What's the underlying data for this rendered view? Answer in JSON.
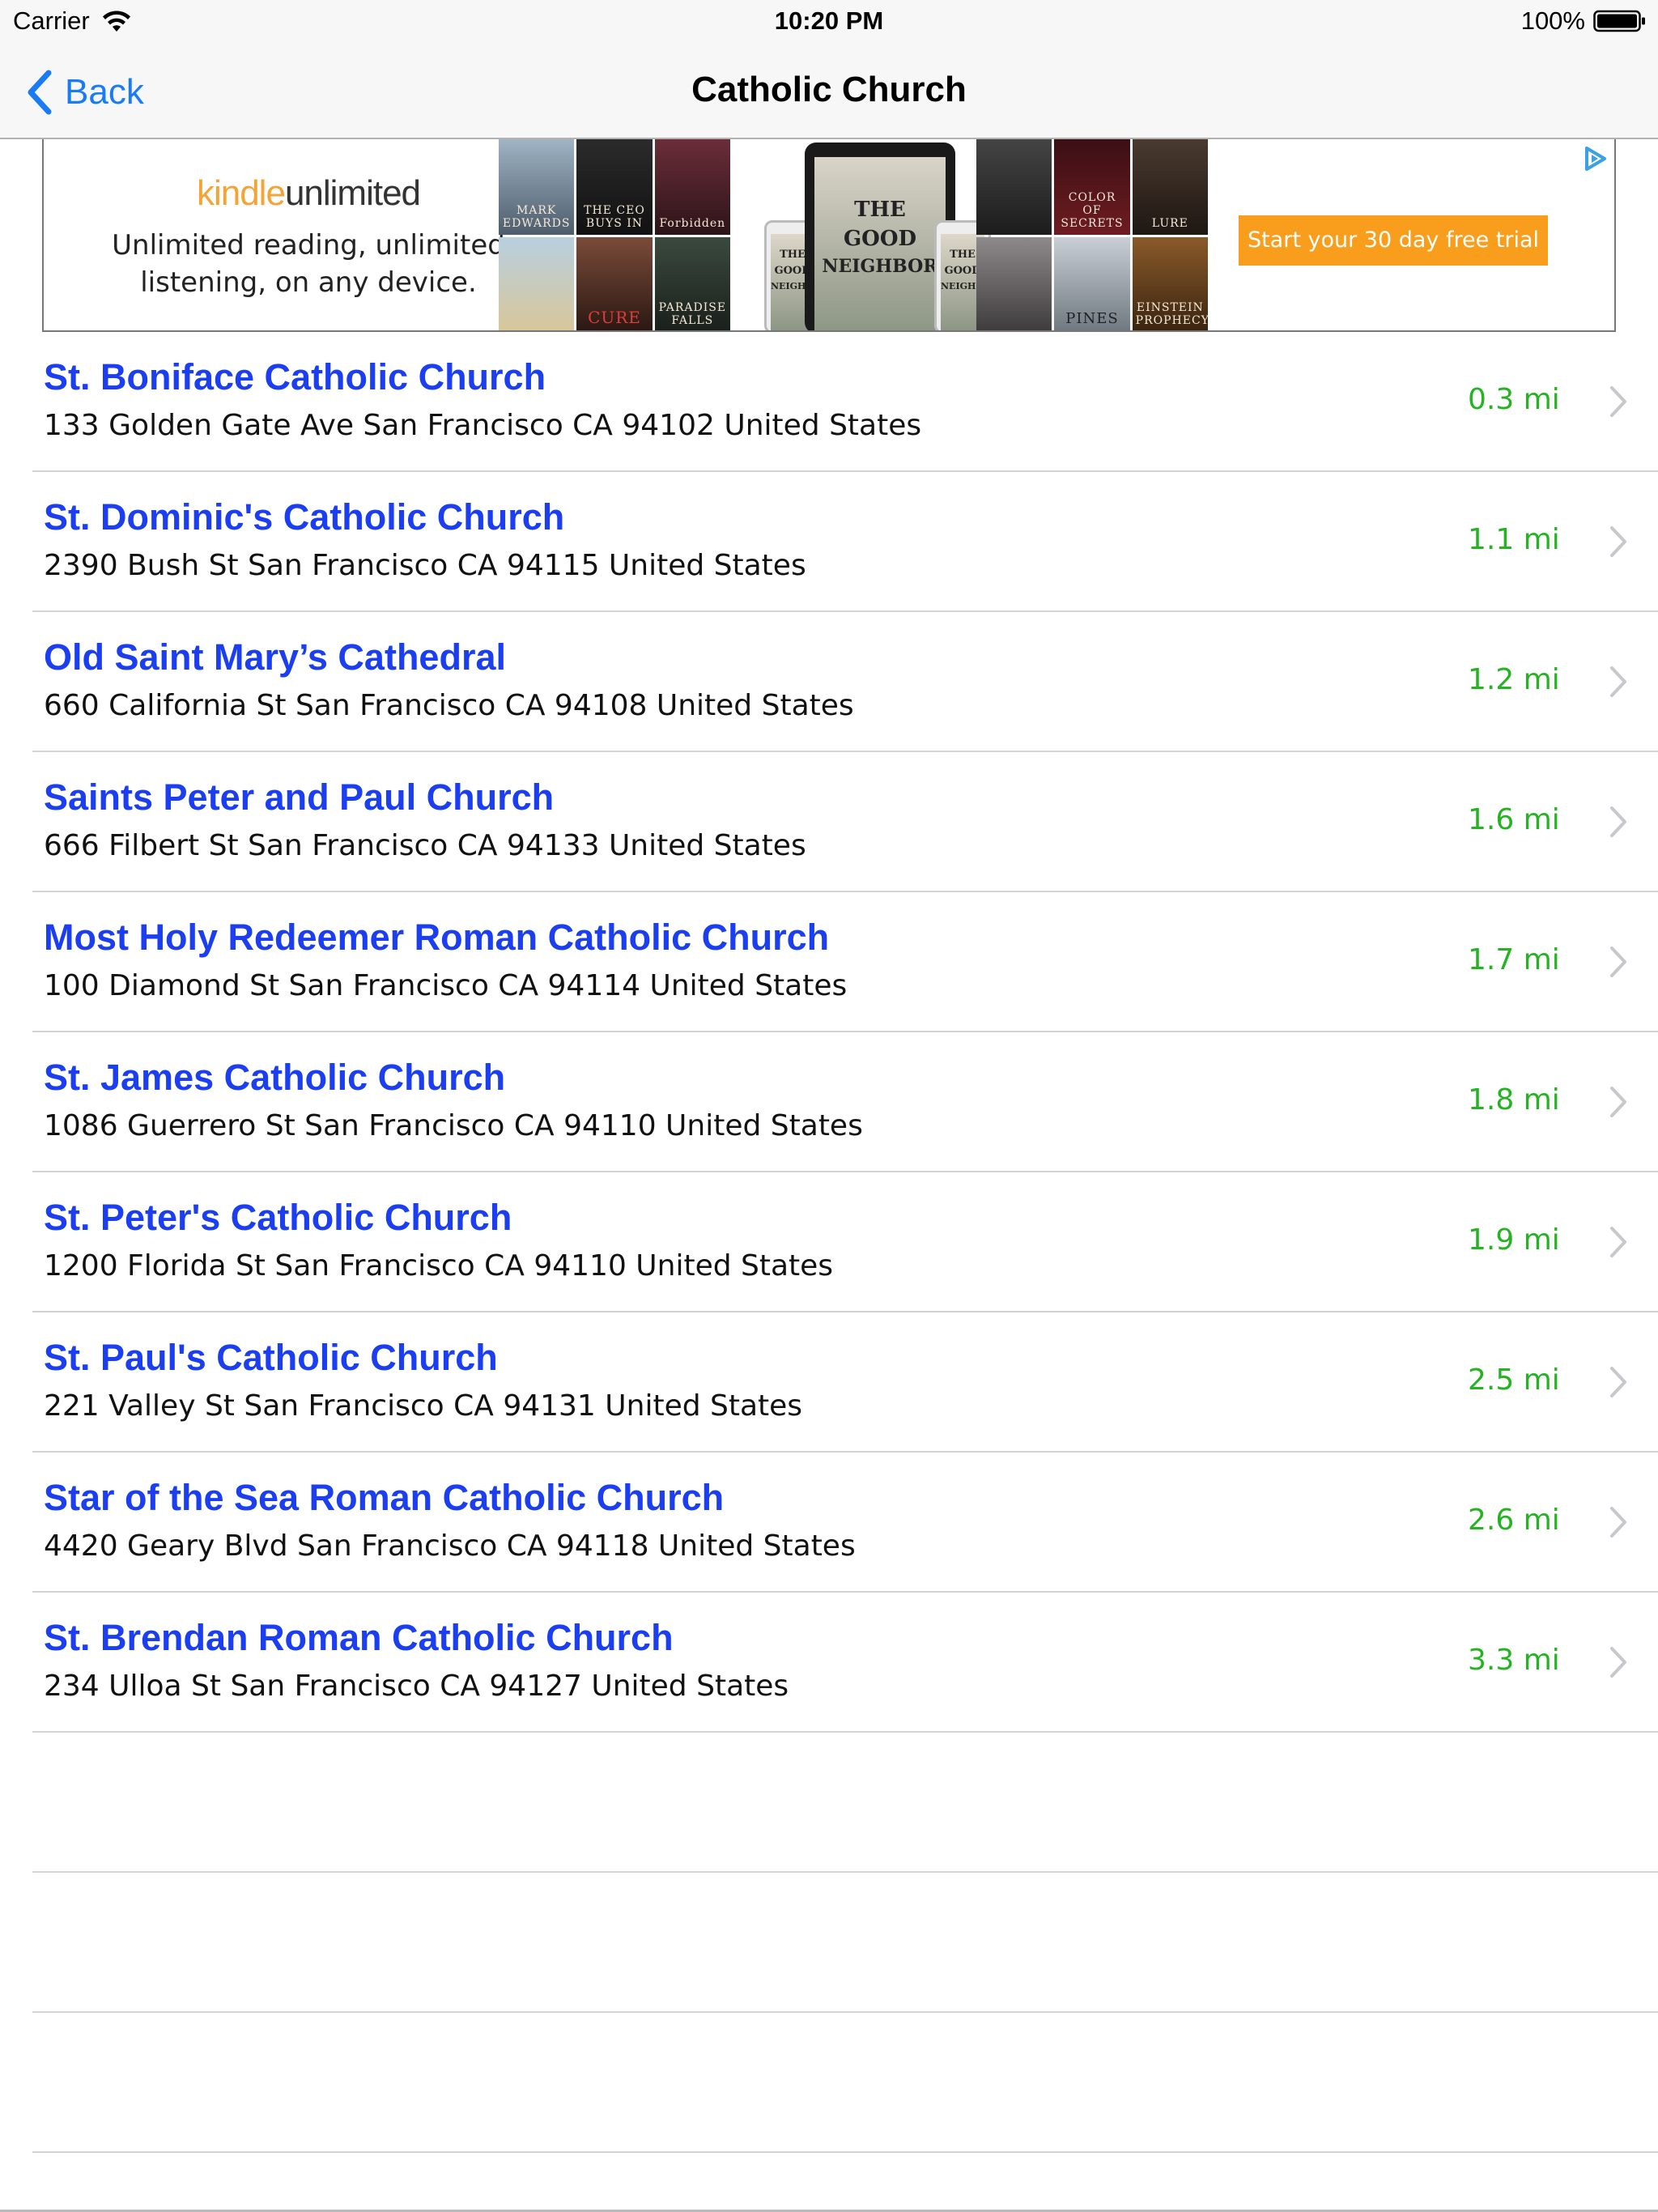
{
  "status_bar": {
    "carrier": "Carrier",
    "time": "10:20 PM",
    "battery": "100%"
  },
  "nav": {
    "back_label": "Back",
    "title": "Catholic Church"
  },
  "ad": {
    "brand_part1": "kindle",
    "brand_part2": "unlimited",
    "tagline_line1": "Unlimited reading, unlimited",
    "tagline_line2": "listening, on any device.",
    "cta": "Start your 30 day free trial",
    "left_books": [
      "MARK EDWARDS",
      "THE CEO BUYS IN",
      "Forbidden",
      "",
      "CURE",
      "PARADISE FALLS"
    ],
    "device_cover_line1": "THE",
    "device_cover_line2": "GOOD",
    "device_cover_line3": "NEIGHBOR",
    "right_books": [
      "",
      "COLOR OF SECRETS",
      "LURE",
      "",
      "PINES",
      "EINSTEIN PROPHECY"
    ]
  },
  "churches": [
    {
      "name": "St. Boniface Catholic Church",
      "address": "133 Golden Gate Ave San Francisco CA 94102 United States",
      "distance": "0.3 mi"
    },
    {
      "name": "St. Dominic's Catholic Church",
      "address": "2390 Bush St San Francisco CA 94115 United States",
      "distance": "1.1 mi"
    },
    {
      "name": "Old Saint Mary’s Cathedral",
      "address": "660 California St San Francisco CA 94108 United States",
      "distance": "1.2 mi"
    },
    {
      "name": "Saints Peter and Paul Church",
      "address": "666 Filbert St San Francisco CA 94133 United States",
      "distance": "1.6 mi"
    },
    {
      "name": "Most Holy Redeemer Roman Catholic Church",
      "address": "100 Diamond St San Francisco CA 94114 United States",
      "distance": "1.7 mi"
    },
    {
      "name": "St. James Catholic Church",
      "address": "1086 Guerrero St San Francisco CA 94110 United States",
      "distance": "1.8 mi"
    },
    {
      "name": "St. Peter's Catholic Church",
      "address": "1200 Florida St San Francisco CA 94110 United States",
      "distance": "1.9 mi"
    },
    {
      "name": "St. Paul's Catholic Church",
      "address": "221 Valley St San Francisco CA 94131 United States",
      "distance": "2.5 mi"
    },
    {
      "name": "Star of the Sea Roman Catholic Church",
      "address": "4420 Geary Blvd San Francisco CA 94118 United States",
      "distance": "2.6 mi"
    },
    {
      "name": "St. Brendan Roman Catholic Church",
      "address": "234 Ulloa St San Francisco CA 94127 United States",
      "distance": "3.3 mi"
    }
  ],
  "colors": {
    "accent_blue": "#1a7cf5",
    "name_blue": "#1b3ff0",
    "distance_green": "#25b322",
    "ad_orange": "#f99d1c"
  }
}
